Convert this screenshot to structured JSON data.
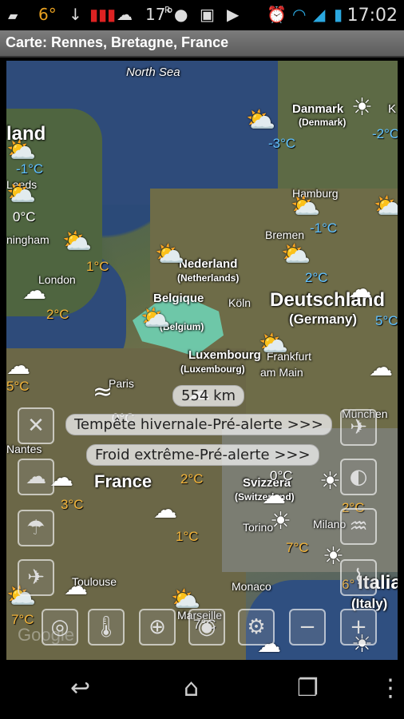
{
  "status_bar": {
    "temp1": "6°",
    "temp2": "17°",
    "temp2_sup": "R",
    "time": "17:02"
  },
  "title": "Carte: Rennes, Bretagne, France",
  "map": {
    "places": {
      "north_sea": "North Sea",
      "denmark": "Danmark",
      "denmark_alt": "(Denmark)",
      "hamburg": "Hamburg",
      "bremen": "Bremen",
      "leeds": "Leeds",
      "birmingham": "ningham",
      "london": "London",
      "nederland": "Nederland",
      "nederland_alt": "(Netherlands)",
      "belgique": "Belgique",
      "belgique_alt": "(Belgium)",
      "koln": "Köln",
      "deutschland": "Deutschland",
      "deutschland_alt": "(Germany)",
      "luxembourg": "Luxembourg",
      "luxembourg_alt": "(Luxembourg)",
      "frankfurt": "Frankfurt",
      "frankfurt_alt": "am Main",
      "paris": "Paris",
      "munchen": "München",
      "nantes": "Nantes",
      "france": "France",
      "svizzera": "Svizzera",
      "svizzera_alt": "(Switzerland)",
      "torino": "Torino",
      "milano": "Milano",
      "toulouse": "Toulouse",
      "monaco": "Monaco",
      "marseille": "Marseille",
      "italia": "Italia",
      "italia_alt": "(Italy)",
      "edge_k": "K",
      "edge_land": "land",
      "google": "Google"
    },
    "temperatures": {
      "t_minus3": "-3°C",
      "t_minus2": "-2°C",
      "t_minus1_uk": "-1°C",
      "t_0_uk": "0°C",
      "t_1_uk": "1°C",
      "t_2_london": "2°C",
      "t_minus1_de": "-1°C",
      "t_2_de": "2°C",
      "t_5_de": "5°C",
      "t_5_west": "5°C",
      "t_0_paris": "0°C",
      "t_3_fr": "3°C",
      "t_2_fr": "2°C",
      "t_1_fr": "1°C",
      "t_0_ch": "0°C",
      "t_2_it": "2°C",
      "t_7_it": "7°C",
      "t_6_it": "6°",
      "t_7_sw": "7°C",
      "t_7_mars": "7°C"
    },
    "distance": "554 km",
    "alerts": [
      "Tempête hivernale-Pré-alerte >>>",
      "Froid extrême-Pré-alerte >>>"
    ]
  },
  "colors": {
    "belgium_highlight": "#6fe6c8",
    "temp_warm": "#f3b43a",
    "temp_cold": "#5fc0ff"
  },
  "icons": {
    "weather": "partly-cloudy-icon",
    "sun": "sun-icon",
    "cloud": "cloud-icon",
    "wind": "wind-arrow-icon"
  }
}
